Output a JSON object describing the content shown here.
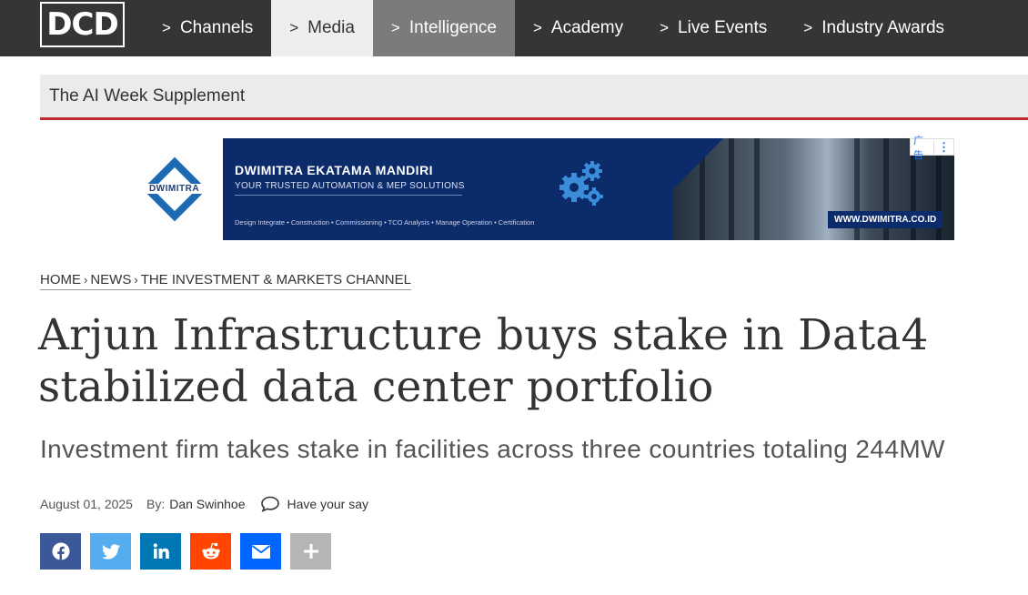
{
  "nav": {
    "logo_text": "DCD",
    "chevron": ">",
    "items": [
      {
        "label": "Channels",
        "state": "normal"
      },
      {
        "label": "Media",
        "state": "hover"
      },
      {
        "label": "Intelligence",
        "state": "active"
      },
      {
        "label": "Academy",
        "state": "normal"
      },
      {
        "label": "Live Events",
        "state": "normal"
      },
      {
        "label": "Industry Awards",
        "state": "normal"
      }
    ]
  },
  "supplement": {
    "label": "The AI Week Supplement",
    "accent_color": "#c0282d"
  },
  "ad": {
    "brand_logo_text": "DWIMITRA",
    "company": "DWIMITRA EKATAMA MANDIRI",
    "tagline": "YOUR TRUSTED AUTOMATION & MEP SOLUTIONS",
    "services": "Design Integrate  •  Construction  •  Commissioning  •  TCO Analysis  •  Manage Operation  •  Certification",
    "url": "WWW.DWIMITRA.CO.ID",
    "ad_label": "广告",
    "ad_menu": "⋮",
    "background_color": "#0c2b6b"
  },
  "breadcrumb": {
    "items": [
      "HOME",
      "NEWS",
      "THE INVESTMENT & MARKETS CHANNEL"
    ],
    "separator": "›"
  },
  "article": {
    "title": "Arjun Infrastructure buys stake in Data4 stabilized data center portfolio",
    "subtitle": "Investment firm takes stake in facilities across three countries totaling 244MW",
    "date": "August 01, 2025",
    "by_label": "By:",
    "author": "Dan Swinhoe",
    "comment_label": "Have your say"
  },
  "share": {
    "buttons": [
      {
        "name": "facebook",
        "icon": "facebook-icon",
        "color": "#3b5998"
      },
      {
        "name": "twitter",
        "icon": "twitter-icon",
        "color": "#55acee"
      },
      {
        "name": "linkedin",
        "icon": "linkedin-icon",
        "color": "#0077b5"
      },
      {
        "name": "reddit",
        "icon": "reddit-icon",
        "color": "#ff4500"
      },
      {
        "name": "email",
        "icon": "email-icon",
        "color": "#0166ff"
      },
      {
        "name": "more",
        "icon": "plus-icon",
        "color": "#b5b5b5"
      }
    ]
  }
}
